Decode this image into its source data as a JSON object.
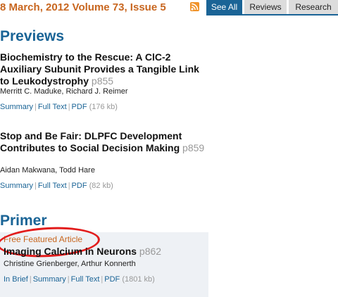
{
  "issue": "8 March, 2012 Volume 73, Issue 5",
  "tabs": [
    "See All",
    "Reviews",
    "Research"
  ],
  "previews": {
    "heading": "Previews",
    "articles": [
      {
        "title": "Biochemistry to the Rescue: A ClC-2 Auxiliary Subunit Provides a Tangible Link to Leukodystrophy",
        "page": "p855",
        "authors": "Merritt C. Maduke, Richard J. Reimer",
        "links": [
          "Summary",
          "Full Text",
          "PDF"
        ],
        "pdf_size": "(176 kb)"
      },
      {
        "title": "Stop and Be Fair: DLPFC Development Contributes to Social Decision Making",
        "page": "p859",
        "authors": "Aidan Makwana, Todd Hare",
        "links": [
          "Summary",
          "Full Text",
          "PDF"
        ],
        "pdf_size": "(82 kb)"
      }
    ]
  },
  "primer": {
    "heading": "Primer",
    "badge": "Free Featured Article",
    "title": "Imaging Calcium in Neurons",
    "page": "p862",
    "authors": "Christine Grienberger, Arthur Konnerth",
    "links": [
      "In Brief",
      "Summary",
      "Full Text",
      "PDF"
    ],
    "pdf_size": "(1801 kb)"
  },
  "colors": {
    "accent_blue": "#1a6496",
    "issue_orange": "#c8661f",
    "highlight_red": "#e21c1c"
  }
}
